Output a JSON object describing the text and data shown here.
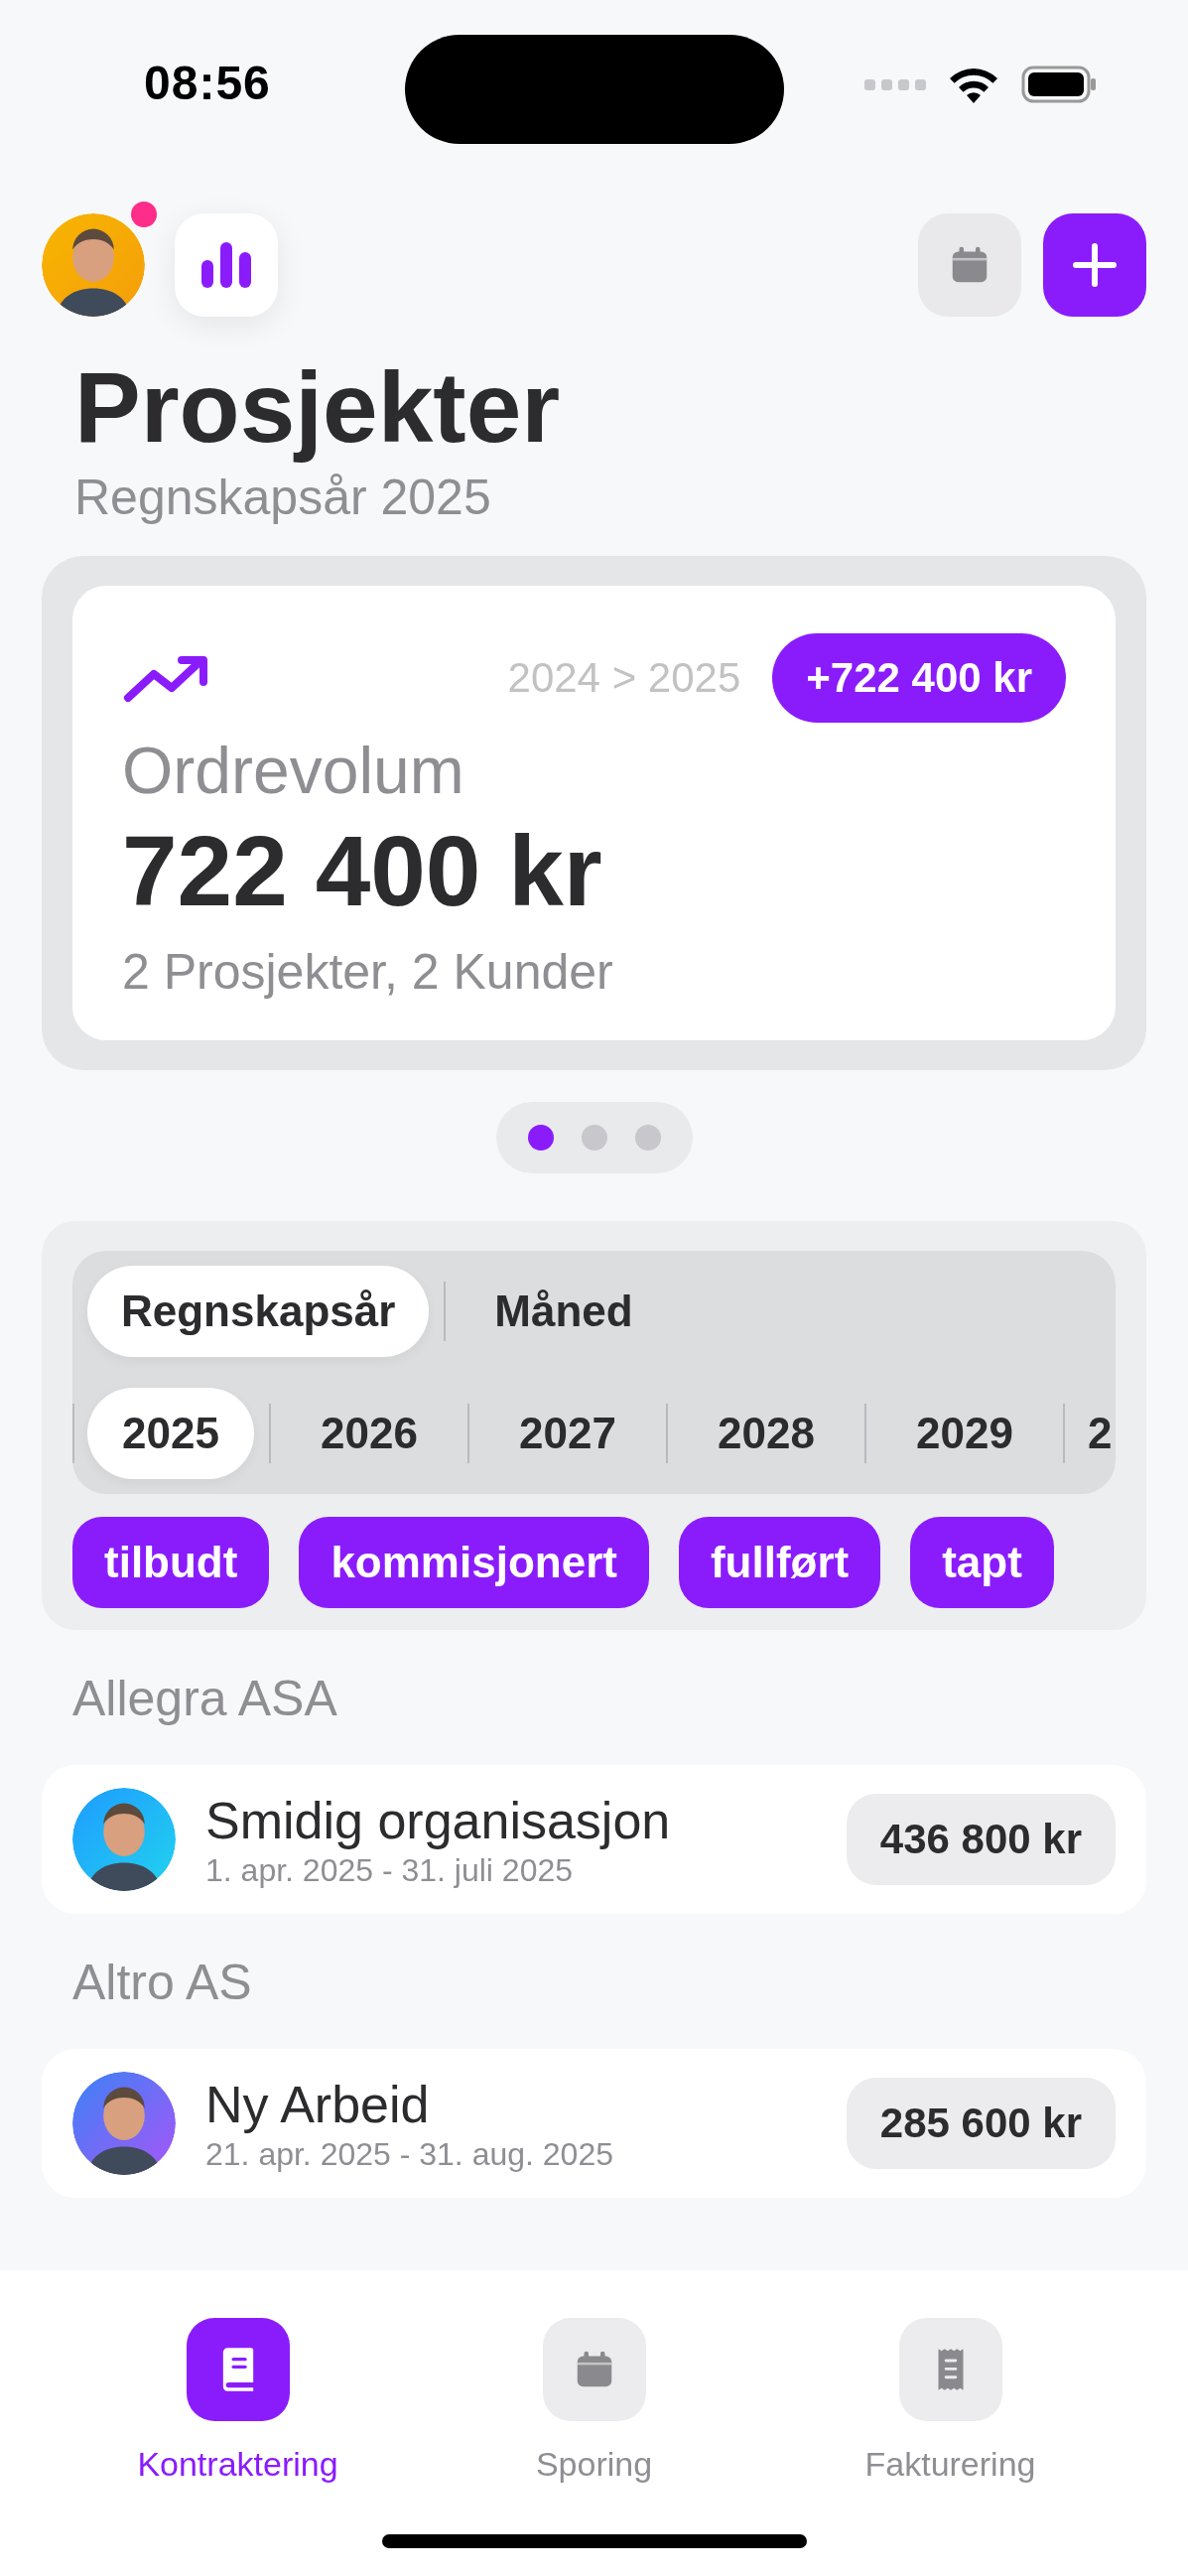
{
  "status_bar": {
    "time": "08:56"
  },
  "header": {
    "notification": true
  },
  "title": "Prosjekter",
  "subtitle": "Regnskapsår 2025",
  "summary": {
    "comparison": "2024 > 2025",
    "change": "+722 400 kr",
    "label": "Ordrevolum",
    "value": "722 400 kr",
    "details": "2 Prosjekter, 2 Kunder"
  },
  "pages": [
    {
      "selected": true
    },
    {
      "selected": false
    },
    {
      "selected": false
    }
  ],
  "period_tabs": [
    {
      "label": "Regnskapsår",
      "selected": true
    },
    {
      "label": "Måned",
      "selected": false
    }
  ],
  "years": [
    {
      "label": "2025",
      "selected": true
    },
    {
      "label": "2026",
      "selected": false
    },
    {
      "label": "2027",
      "selected": false
    },
    {
      "label": "2028",
      "selected": false
    },
    {
      "label": "2029",
      "selected": false
    },
    {
      "label": "2",
      "selected": false
    }
  ],
  "status_filters": [
    {
      "label": "tilbudt"
    },
    {
      "label": "kommisjonert"
    },
    {
      "label": "fullført"
    },
    {
      "label": "tapt"
    }
  ],
  "groups": [
    {
      "customer": "Allegra ASA",
      "projects": [
        {
          "name": "Smidig organisasjon",
          "dates": "1. apr. 2025 - 31. juli 2025",
          "amount": "436 800 kr"
        }
      ]
    },
    {
      "customer": "Altro AS",
      "projects": [
        {
          "name": "Ny Arbeid",
          "dates": "21. apr. 2025 - 31. aug. 2025",
          "amount": "285 600 kr"
        }
      ]
    }
  ],
  "tab_bar": [
    {
      "label": "Kontraktering",
      "kind": "book",
      "selected": true
    },
    {
      "label": "Sporing",
      "kind": "calendar",
      "selected": false
    },
    {
      "label": "Fakturering",
      "kind": "receipt",
      "selected": false
    }
  ]
}
